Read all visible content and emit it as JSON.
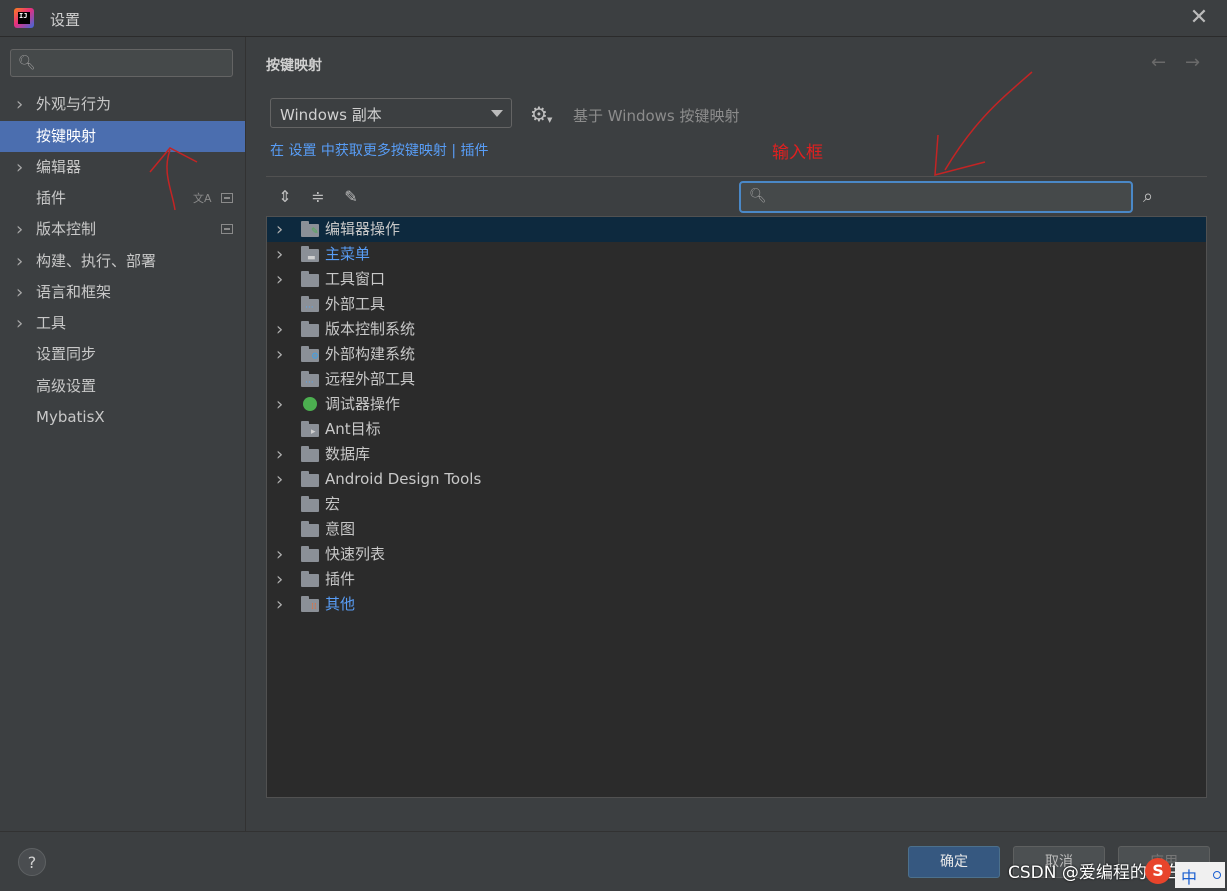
{
  "window": {
    "title": "设置"
  },
  "sidebar": {
    "search_placeholder": "",
    "items": [
      {
        "label": "外观与行为",
        "expandable": true
      },
      {
        "label": "按键映射",
        "expandable": false,
        "selected": true
      },
      {
        "label": "编辑器",
        "expandable": true
      },
      {
        "label": "插件",
        "expandable": false
      },
      {
        "label": "版本控制",
        "expandable": true
      },
      {
        "label": "构建、执行、部署",
        "expandable": true
      },
      {
        "label": "语言和框架",
        "expandable": true
      },
      {
        "label": "工具",
        "expandable": true
      },
      {
        "label": "设置同步",
        "expandable": false
      },
      {
        "label": "高级设置",
        "expandable": false
      },
      {
        "label": "MybatisX",
        "expandable": false
      }
    ]
  },
  "main": {
    "title": "按键映射",
    "keymap_selected": "Windows 副本",
    "based_on": "基于 Windows 按键映射",
    "link_prefix": "在",
    "link_settings": "设置",
    "link_middle": "中获取更多按键映射",
    "link_sep": "|",
    "link_plugins": "插件",
    "search_placeholder": ""
  },
  "annotation": {
    "text": "输入框",
    "color": "#e02020"
  },
  "tree": [
    {
      "label": "编辑器操作",
      "expandable": true,
      "selected": true
    },
    {
      "label": "主菜单",
      "expandable": true,
      "highlight": true
    },
    {
      "label": "工具窗口",
      "expandable": true
    },
    {
      "label": "外部工具",
      "expandable": false
    },
    {
      "label": "版本控制系统",
      "expandable": true
    },
    {
      "label": "外部构建系统",
      "expandable": true
    },
    {
      "label": "远程外部工具",
      "expandable": false
    },
    {
      "label": "调试器操作",
      "expandable": true
    },
    {
      "label": "Ant目标",
      "expandable": false
    },
    {
      "label": "数据库",
      "expandable": true
    },
    {
      "label": "Android Design Tools",
      "expandable": true
    },
    {
      "label": "宏",
      "expandable": false
    },
    {
      "label": "意图",
      "expandable": false
    },
    {
      "label": "快速列表",
      "expandable": true
    },
    {
      "label": "插件",
      "expandable": true
    },
    {
      "label": "其他",
      "expandable": true,
      "highlight": true
    }
  ],
  "buttons": {
    "ok": "确定",
    "cancel": "取消",
    "apply": "应用"
  },
  "help_label": "?",
  "watermark": "CSDN @爱编程的小白",
  "ime": {
    "mode": "中"
  },
  "colors": {
    "accent": "#4b6eaf",
    "link": "#589df6",
    "selection": "#0d293e",
    "focus": "#4a88c7"
  }
}
